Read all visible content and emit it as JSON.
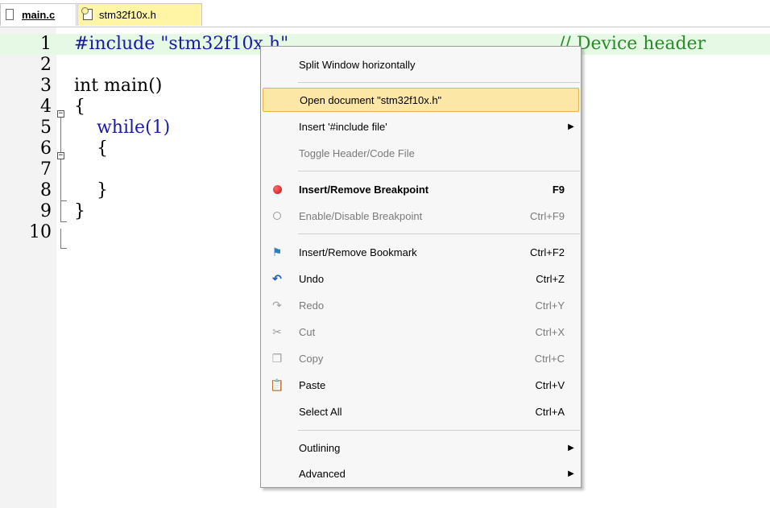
{
  "tabs": [
    {
      "label": "main.c",
      "active": true
    },
    {
      "label": "stm32f10x.h",
      "active": false
    }
  ],
  "editor": {
    "lines": [
      {
        "num": "1",
        "code": "#include \"stm32f10x.h\"",
        "comment": "// Device header"
      },
      {
        "num": "2",
        "code": ""
      },
      {
        "num": "3",
        "code": "int main()"
      },
      {
        "num": "4",
        "code": "{"
      },
      {
        "num": "5",
        "code": "    while(1)"
      },
      {
        "num": "6",
        "code": "    {"
      },
      {
        "num": "7",
        "code": ""
      },
      {
        "num": "8",
        "code": "    }"
      },
      {
        "num": "9",
        "code": "}"
      },
      {
        "num": "10",
        "code": ""
      }
    ]
  },
  "menu": {
    "items": [
      {
        "label": "Split Window horizontally",
        "shortcut": ""
      },
      {
        "label": "Open document \"stm32f10x.h\"",
        "shortcut": ""
      },
      {
        "label": "Insert '#include file'",
        "shortcut": ""
      },
      {
        "label": "Toggle Header/Code File",
        "shortcut": ""
      },
      {
        "label": "Insert/Remove Breakpoint",
        "shortcut": "F9"
      },
      {
        "label": "Enable/Disable Breakpoint",
        "shortcut": "Ctrl+F9"
      },
      {
        "label": "Insert/Remove Bookmark",
        "shortcut": "Ctrl+F2"
      },
      {
        "label": "Undo",
        "shortcut": "Ctrl+Z"
      },
      {
        "label": "Redo",
        "shortcut": "Ctrl+Y"
      },
      {
        "label": "Cut",
        "shortcut": "Ctrl+X"
      },
      {
        "label": "Copy",
        "shortcut": "Ctrl+C"
      },
      {
        "label": "Paste",
        "shortcut": "Ctrl+V"
      },
      {
        "label": "Select All",
        "shortcut": "Ctrl+A"
      },
      {
        "label": "Outlining",
        "shortcut": ""
      },
      {
        "label": "Advanced",
        "shortcut": ""
      }
    ]
  },
  "colors": {
    "keyword": "#1a1aa6",
    "comment": "#2a8a2a",
    "highlight_line": "#e5f9e5",
    "tab_active": "#fff5a4",
    "menu_selected": "#fde7a6"
  }
}
